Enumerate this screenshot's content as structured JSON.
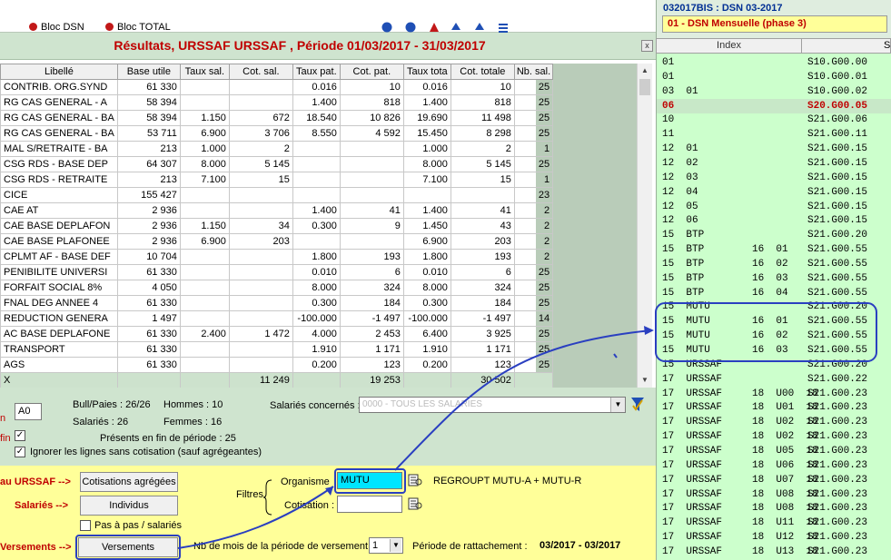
{
  "toolbar": {
    "items": [
      "Bloc DSN",
      "Bloc TOTAL"
    ],
    "icon_colors": [
      "#1f4fb5",
      "#1f4fb5",
      "#c21818",
      "#1f4fb5",
      "#1f4fb5"
    ]
  },
  "title": "Résultats, URSSAF URSSAF , Période 01/03/2017 - 31/03/2017",
  "grid": {
    "columns": [
      "Libellé",
      "Base utile",
      "Taux sal.",
      "Cot. sal.",
      "Taux pat.",
      "Cot. pat.",
      "Taux tota",
      "Cot. totale",
      "Nb. sal."
    ],
    "rows": [
      [
        "CONTRIB. ORG.SYND",
        "61 330",
        "",
        "",
        "0.016",
        "10",
        "0.016",
        "10",
        "25"
      ],
      [
        "RG CAS GENERAL - A",
        "58 394",
        "",
        "",
        "1.400",
        "818",
        "1.400",
        "818",
        "25"
      ],
      [
        "RG CAS GENERAL - BA",
        "58 394",
        "1.150",
        "672",
        "18.540",
        "10 826",
        "19.690",
        "11 498",
        "25"
      ],
      [
        "RG CAS GENERAL - BA",
        "53 711",
        "6.900",
        "3 706",
        "8.550",
        "4 592",
        "15.450",
        "8 298",
        "25"
      ],
      [
        "MAL S/RETRAITE - BA",
        "213",
        "1.000",
        "2",
        "",
        "",
        "1.000",
        "2",
        "1"
      ],
      [
        "CSG RDS - BASE DEP",
        "64 307",
        "8.000",
        "5 145",
        "",
        "",
        "8.000",
        "5 145",
        "25"
      ],
      [
        "CSG RDS - RETRAITE",
        "213",
        "7.100",
        "15",
        "",
        "",
        "7.100",
        "15",
        "1"
      ],
      [
        "CICE",
        "155 427",
        "",
        "",
        "",
        "",
        "",
        "",
        "23"
      ],
      [
        "CAE AT",
        "2 936",
        "",
        "",
        "1.400",
        "41",
        "1.400",
        "41",
        "2"
      ],
      [
        "CAE BASE DEPLAFON",
        "2 936",
        "1.150",
        "34",
        "0.300",
        "9",
        "1.450",
        "43",
        "2"
      ],
      [
        "CAE BASE PLAFONEE",
        "2 936",
        "6.900",
        "203",
        "",
        "",
        "6.900",
        "203",
        "2"
      ],
      [
        "CPLMT AF - BASE DEF",
        "10 704",
        "",
        "",
        "1.800",
        "193",
        "1.800",
        "193",
        "2"
      ],
      [
        "PENIBILITE UNIVERSI",
        "61 330",
        "",
        "",
        "0.010",
        "6",
        "0.010",
        "6",
        "25"
      ],
      [
        "FORFAIT SOCIAL 8%",
        "4 050",
        "",
        "",
        "8.000",
        "324",
        "8.000",
        "324",
        "25"
      ],
      [
        "FNAL DEG ANNEE 4",
        "61 330",
        "",
        "",
        "0.300",
        "184",
        "0.300",
        "184",
        "25"
      ],
      [
        "REDUCTION GENERA",
        "1 497",
        "",
        "",
        "-100.000",
        "-1 497",
        "-100.000",
        "-1 497",
        "14"
      ],
      [
        "AC BASE DEPLAFONE",
        "61 330",
        "2.400",
        "1 472",
        "4.000",
        "2 453",
        "6.400",
        "3 925",
        "25"
      ],
      [
        "TRANSPORT",
        "61 330",
        "",
        "",
        "1.910",
        "1 171",
        "1.910",
        "1 171",
        "25"
      ],
      [
        "AGS",
        "61 330",
        "",
        "",
        "0.200",
        "123",
        "0.200",
        "123",
        "25"
      ]
    ],
    "total": [
      "X",
      "",
      "",
      "11 249",
      "",
      "19 253",
      "",
      "30 502",
      ""
    ]
  },
  "mid": {
    "left_a_red": "n",
    "left_b_red": "fin",
    "code_value": "A0",
    "bull": "Bull/Paies : 26/26",
    "hommes": "Hommes : 10",
    "salaries": "Salariés : 26",
    "femmes": "Femmes : 16",
    "presents": "Présents en fin de période : 25",
    "ignore": "Ignorer les lignes sans cotisation (sauf agrégeantes)",
    "sal_concernes": "Salariés concernés :",
    "sal_value": "0000 - TOUS LES SALARIES"
  },
  "bottom": {
    "urssaf_lbl": "au URSSAF -->",
    "salaries_lbl": "Salariés -->",
    "versements_lbl": "Versements -->",
    "btn_cotisations": "Cotisations agrégées",
    "btn_individus": "Individus",
    "pas_a_pas": "Pas à pas / salariés",
    "btn_versements": "Versements",
    "filtres": "Filtres",
    "organisme": "Organisme",
    "organisme_value": "MUTU",
    "cotisation": "Cotisation :",
    "regroupt": "REGROUPT MUTU-A + MUTU-R",
    "nb_mois": "Nb de mois de la période de versement :",
    "nb_mois_value": "1",
    "periode_rattachement": "Période de rattachement :",
    "periode_value": "03/2017 - 03/2017"
  },
  "right": {
    "title": "032017BIS : DSN 03-2017",
    "subtitle": "01 - DSN Mensuelle (phase 3)",
    "col_index": "Index",
    "col_s": "S",
    "rows": [
      [
        "01",
        "S10.G00.00"
      ],
      [
        "01",
        "S10.G00.01"
      ],
      [
        "03  01",
        "S10.G00.02"
      ],
      [
        "06",
        "S20.G00.05"
      ],
      [
        "10",
        "S21.G00.06"
      ],
      [
        "11",
        "S21.G00.11"
      ],
      [
        "12  01",
        "S21.G00.15"
      ],
      [
        "12  02",
        "S21.G00.15"
      ],
      [
        "12  03",
        "S21.G00.15"
      ],
      [
        "12  04",
        "S21.G00.15"
      ],
      [
        "12  05",
        "S21.G00.15"
      ],
      [
        "12  06",
        "S21.G00.15"
      ],
      [
        "15  BTP",
        "S21.G00.20"
      ],
      [
        "15  BTP        16  01",
        "S21.G00.55"
      ],
      [
        "15  BTP        16  02",
        "S21.G00.55"
      ],
      [
        "15  BTP        16  03",
        "S21.G00.55"
      ],
      [
        "15  BTP        16  04",
        "S21.G00.55"
      ],
      [
        "15  MUTU",
        "S21.G00.20"
      ],
      [
        "15  MUTU       16  01",
        "S21.G00.55"
      ],
      [
        "15  MUTU       16  02",
        "S21.G00.55"
      ],
      [
        "15  MUTU       16  03",
        "S21.G00.55"
      ],
      [
        "15  URSSAF",
        "S21.G00.20"
      ],
      [
        "17  URSSAF",
        "S21.G00.22"
      ],
      [
        "17  URSSAF     18  U00  18",
        "S21.G00.23"
      ],
      [
        "17  URSSAF     18  U01  18",
        "S21.G00.23"
      ],
      [
        "17  URSSAF     18  U02  18",
        "S21.G00.23"
      ],
      [
        "17  URSSAF     18  U02  18",
        "S21.G00.23"
      ],
      [
        "17  URSSAF     18  U05  18",
        "S21.G00.23"
      ],
      [
        "17  URSSAF     18  U06  18",
        "S21.G00.23"
      ],
      [
        "17  URSSAF     18  U07  18",
        "S21.G00.23"
      ],
      [
        "17  URSSAF     18  U08  18",
        "S21.G00.23"
      ],
      [
        "17  URSSAF     18  U08  18",
        "S21.G00.23"
      ],
      [
        "17  URSSAF     18  U11  18",
        "S21.G00.23"
      ],
      [
        "17  URSSAF     18  U12  18",
        "S21.G00.23"
      ],
      [
        "17  URSSAF     18  U13  18",
        "S21.G00.23"
      ]
    ],
    "selected_index": 3
  },
  "colors": {
    "title_red": "#c00000",
    "header_green": "#cfe4cf",
    "list_green": "#ccffcc",
    "yellow": "#ffff99",
    "annotation_blue": "#2a3fc0",
    "input_cyan": "#00e5ff"
  }
}
